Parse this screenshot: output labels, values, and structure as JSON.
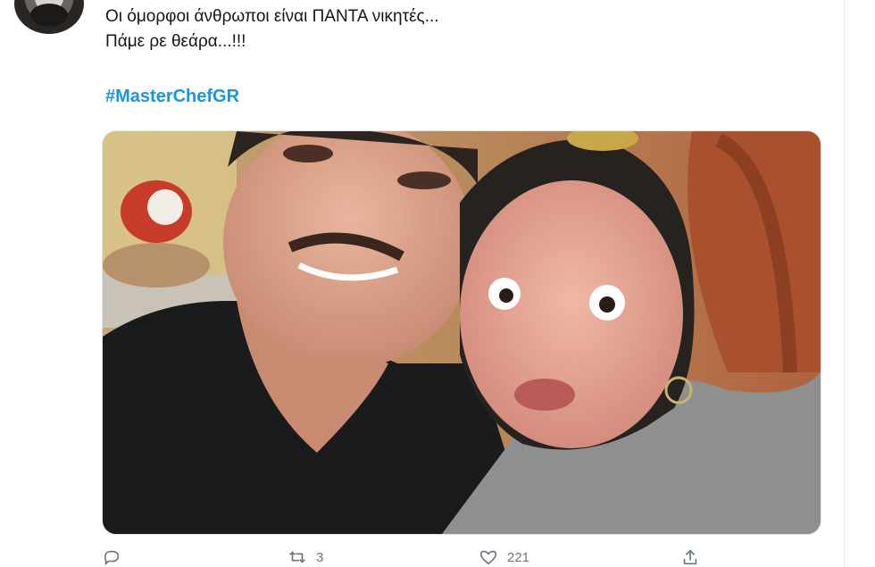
{
  "tweet": {
    "lines": [
      "Οι όμορφοι άνθρωποι είναι ΠΑΝΤΑ νικητές...",
      "Πάμε ρε θεάρα...!!!"
    ],
    "hashtag": "#MasterChefGR"
  },
  "actions": {
    "reply_count": "",
    "retweet_count": "3",
    "like_count": "221"
  },
  "icons": [
    "reply-icon",
    "retweet-icon",
    "like-icon",
    "share-icon"
  ],
  "colors": {
    "text": "#14171a",
    "link": "#1b95e0",
    "muted": "#657786"
  }
}
